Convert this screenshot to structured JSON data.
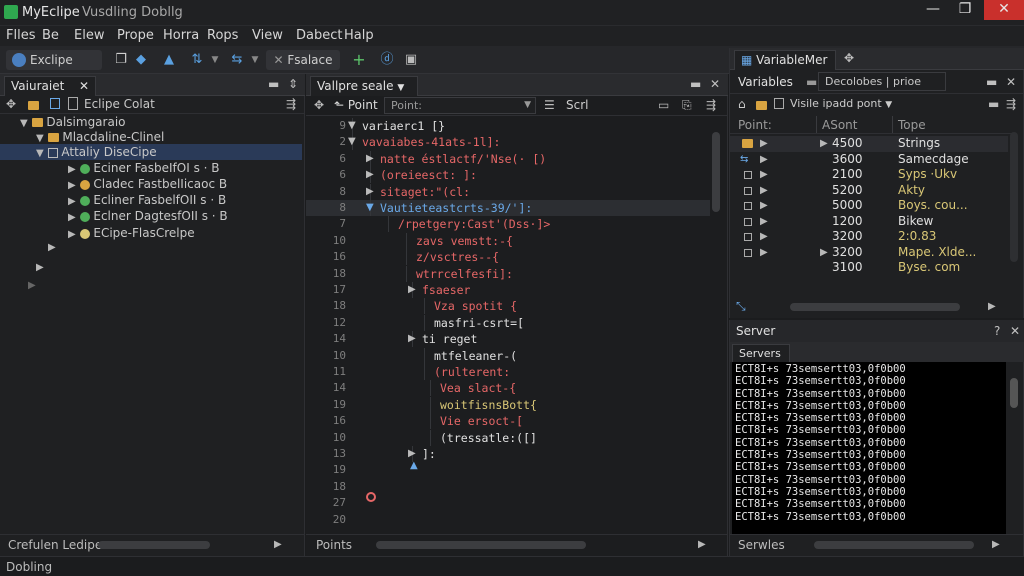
{
  "window": {
    "title": "MyEclipe",
    "subtitle": "Vusdling Dobllg",
    "controls": {
      "minimize": "—",
      "maximize": "❐",
      "close": "✕"
    }
  },
  "menu": [
    "Flles",
    "Be",
    "Elew",
    "Prope",
    "Horra",
    "Rops",
    "View",
    "Dabect",
    "Halp"
  ],
  "toolbar": {
    "perspective_label": "Exclipe",
    "search_label": "Fsalace",
    "icons": [
      "debug-icon",
      "copy-icon",
      "step-icon",
      "step-into-icon",
      "step-over-icon",
      "run-icon",
      "add-icon",
      "info-icon",
      "save-icon"
    ]
  },
  "left_panel": {
    "tab": "Vaiuraiet",
    "header_label": "Eclipe Colat",
    "tree": [
      {
        "label": "Dalsimgaraio",
        "level": 1,
        "expanded": true,
        "icon": "folder"
      },
      {
        "label": "Mlacdaline-Clinel",
        "level": 2,
        "expanded": true,
        "icon": "folder"
      },
      {
        "label": "Attaliy DiseCipe",
        "level": 2,
        "expanded": true,
        "icon": "package",
        "selected": true
      },
      {
        "label": "Eciner FasbeIfOI s · B",
        "level": 3,
        "icon": "class-green"
      },
      {
        "label": "Cladec FastbelIicaoc B",
        "level": 3,
        "icon": "class-orange"
      },
      {
        "label": "Ecliner FasbelfOII s · B",
        "level": 3,
        "icon": "class-green"
      },
      {
        "label": "Eclner DagtesfOII s · B",
        "level": 3,
        "icon": "class-green"
      },
      {
        "label": "ECipe-FlasCrelpe",
        "level": 2,
        "icon": "class-yellow"
      }
    ],
    "footer_label": "Crefulen Ledipe"
  },
  "editor": {
    "tab": "Vallpre seale",
    "toolbar": {
      "point_label": "Point",
      "point_field": "Point:",
      "scroll_label": "Scrl"
    },
    "lines": [
      {
        "n": "9",
        "text": "variaerc1 [}",
        "color": "kw-white",
        "marker": "▼"
      },
      {
        "n": "2",
        "text": "vavaiabes-41ats-1l]:",
        "color": "kw-red",
        "marker": "▼"
      },
      {
        "n": "6",
        "text": "natte éstlactf/'Nse(· [)",
        "color": "kw-red",
        "marker": "▶"
      },
      {
        "n": "6",
        "text": "(oreieesct: ]:",
        "color": "kw-red",
        "marker": "▶"
      },
      {
        "n": "8",
        "text": "sitaget:\"(cl:",
        "color": "kw-red",
        "marker": "▶"
      },
      {
        "n": "8",
        "text": "Vautieteastcrts-39/']:",
        "color": "kw-blue",
        "marker": "▼",
        "highlight": true
      },
      {
        "n": "7",
        "text": "/rpetgery:Cast'(Dss·]>",
        "color": "kw-red"
      },
      {
        "n": "10",
        "text": "zavs vemstt:-{",
        "color": "kw-red"
      },
      {
        "n": "16",
        "text": "z/vsctres--{",
        "color": "kw-red"
      },
      {
        "n": "18",
        "text": "wtrrcelfesfi]:",
        "color": "kw-red"
      },
      {
        "n": "17",
        "text": "fsaeser",
        "color": "kw-red",
        "marker": "▶"
      },
      {
        "n": "18",
        "text": "Vza spotit {",
        "color": "kw-red"
      },
      {
        "n": "12",
        "text": "masfri-csrt=[",
        "color": "kw-white"
      },
      {
        "n": "14",
        "text": "ti reget",
        "color": "kw-white",
        "marker": "▶"
      },
      {
        "n": "10",
        "text": "mtfeleaner-(",
        "color": "kw-white"
      },
      {
        "n": "11",
        "text": "(rulterent:",
        "color": "kw-red"
      },
      {
        "n": "14",
        "text": "Vea slact-{",
        "color": "kw-red"
      },
      {
        "n": "19",
        "text": "woitfisnsBott{",
        "color": "kw-yellow"
      },
      {
        "n": "16",
        "text": "Vie ersoct-[",
        "color": "kw-red"
      },
      {
        "n": "10",
        "text": "(tressatle:([]",
        "color": "kw-white"
      },
      {
        "n": "13",
        "text": "]:",
        "color": "kw-white",
        "marker": "▶"
      },
      {
        "n": "19",
        "text": "",
        "color": "kw-white"
      },
      {
        "n": "18",
        "text": "",
        "color": "kw-white"
      },
      {
        "n": "27",
        "text": "",
        "color": "kw-white"
      },
      {
        "n": "20",
        "text": "",
        "color": "kw-white"
      }
    ],
    "footer_label": "Points"
  },
  "variables_panel": {
    "outer_tab": "VariableMer",
    "title": "Variables",
    "sub_tab": "Decolobes",
    "sub_tab2": "prioe",
    "toolbar_label": "Visile ipadd pont",
    "columns": [
      "Point:",
      "ASont",
      "Tope"
    ],
    "rows": [
      {
        "icon": "folder",
        "value": "4500",
        "type": "Strings"
      },
      {
        "icon": "arrows",
        "value": "3600",
        "type": "Samecdage"
      },
      {
        "icon": "box",
        "value": "2100",
        "type": "Syps ·Ukv"
      },
      {
        "icon": "box",
        "value": "5200",
        "type": "Akty"
      },
      {
        "icon": "box",
        "value": "5000",
        "type": "Boys. cou..."
      },
      {
        "icon": "box",
        "value": "1200",
        "type": "Bikew"
      },
      {
        "icon": "box",
        "value": "3200",
        "type": "2:0.83"
      },
      {
        "icon": "box",
        "value": "3200",
        "type": "Mape. Xlde..."
      },
      {
        "icon": "none",
        "value": "3100",
        "type": "Byse. com"
      }
    ]
  },
  "server_panel": {
    "title": "Server",
    "tab": "Servers",
    "console_line": "ECT8I+s 73semsertt03,0f0b00",
    "console_count": 13,
    "footer_label": "Serwles"
  },
  "status_bar": {
    "text": "Dobling"
  },
  "colors": {
    "accent": "#2a3a58",
    "code_red": "#e66767",
    "code_yellow": "#d9c776",
    "code_blue": "#6aa9e8",
    "close_button": "#c9302c"
  }
}
